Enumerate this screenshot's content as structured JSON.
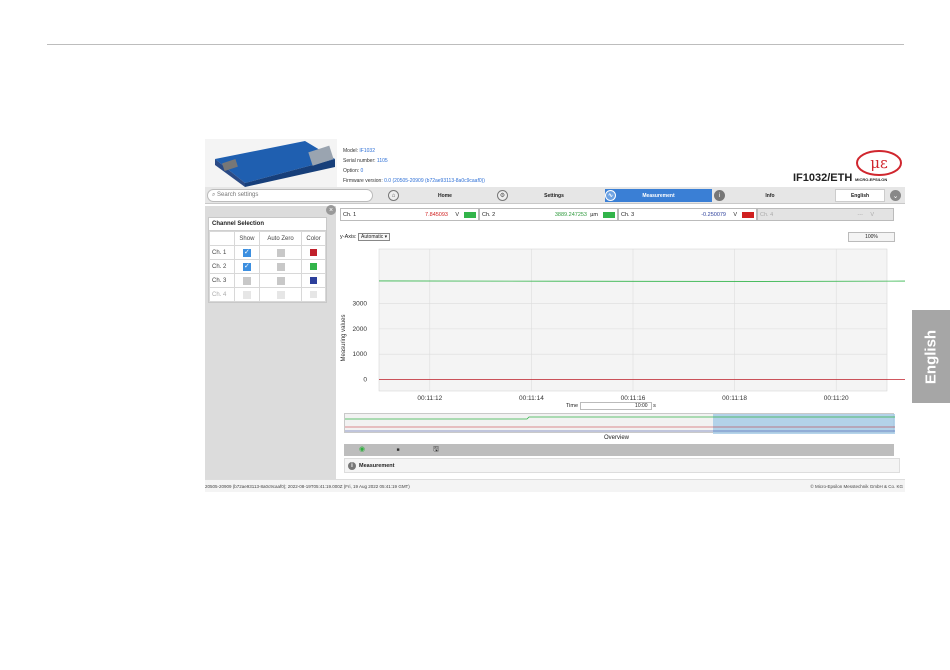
{
  "side_tab": {
    "label": "English"
  },
  "header": {
    "info": [
      {
        "label": "Model:",
        "value": "IF1032"
      },
      {
        "label": "Serial number:",
        "value": "1105"
      },
      {
        "label": "Option:",
        "value": "0"
      },
      {
        "label": "Firmware version:",
        "value": "0.0 (20505-20909 (b72ae93113-8a0c9caaf0))"
      }
    ],
    "product": "IF1032/ETH",
    "logo_text": "MICRO-EPSILON"
  },
  "nav": {
    "search_placeholder": "Search settings",
    "items": [
      {
        "label": "Home",
        "icon": "home-icon"
      },
      {
        "label": "Settings",
        "icon": "gear-icon"
      },
      {
        "label": "Measurement",
        "icon": "measurement-icon",
        "active": true
      },
      {
        "label": "Info",
        "icon": "info-icon"
      }
    ],
    "language": "English"
  },
  "channel_selection": {
    "title": "Channel Selection",
    "headers": [
      "",
      "Show",
      "Auto Zero",
      "Color"
    ],
    "rows": [
      {
        "label": "Ch. 1",
        "show": true,
        "color": "#c0202b",
        "enabled": true
      },
      {
        "label": "Ch. 2",
        "show": true,
        "color": "#32b44a",
        "enabled": true
      },
      {
        "label": "Ch. 3",
        "show": false,
        "color": "#2c3f9b",
        "enabled": true
      },
      {
        "label": "Ch. 4",
        "show": false,
        "color": "#e6e6e6",
        "enabled": false
      }
    ]
  },
  "channels": [
    {
      "name": "Ch. 1",
      "value": "7.845093",
      "unit": "V",
      "value_color": "#d02020",
      "swatch": "#32b44a"
    },
    {
      "name": "Ch. 2",
      "value": "3889.247253",
      "unit": "µm",
      "value_color": "#2f9a3d",
      "swatch": "#32b44a"
    },
    {
      "name": "Ch. 3",
      "value": "-0.250079",
      "unit": "V",
      "value_color": "#2c3f9b",
      "swatch": "#d02020"
    },
    {
      "name": "Ch. 4",
      "value": "---",
      "unit": "V",
      "value_color": "#aaaaaa",
      "swatch": ""
    }
  ],
  "yaxis": {
    "label": "y-Axis:",
    "mode": "Automatic"
  },
  "zoom": "100%",
  "time": {
    "label": "Time",
    "value": "10:00",
    "unit": "s"
  },
  "overview_label": "Overview",
  "measurement_label": "Measurement",
  "footer": {
    "left": "20505-20909 (b72ae93113-8a0c9caaf0); 2022-08-19T05:41:19.000Z (Fri, 19 Aug 2022 05:41:19 GMT)",
    "right": "© Micro-Epsilon Messtechnik GmbH & Co. KG"
  },
  "chart_data": {
    "type": "line",
    "title": "",
    "xlabel": "",
    "ylabel": "Measuring values",
    "x_ticks": [
      "00:11:12",
      "00:11:14",
      "00:11:16",
      "00:11:18",
      "00:11:20"
    ],
    "y_ticks": [
      0,
      1000,
      2000,
      3000
    ],
    "ylim": [
      -450,
      5150
    ],
    "grid": true,
    "series": [
      {
        "color": "#32b44a",
        "x": [
          "00:11:11",
          "00:11:14.5",
          "00:11:18.5",
          "00:11:22"
        ],
        "y": [
          3890,
          3880,
          3870,
          3889
        ]
      },
      {
        "color": "#c0202b",
        "x": [
          "00:11:11",
          "00:11:22"
        ],
        "y": [
          0,
          0
        ]
      }
    ]
  }
}
